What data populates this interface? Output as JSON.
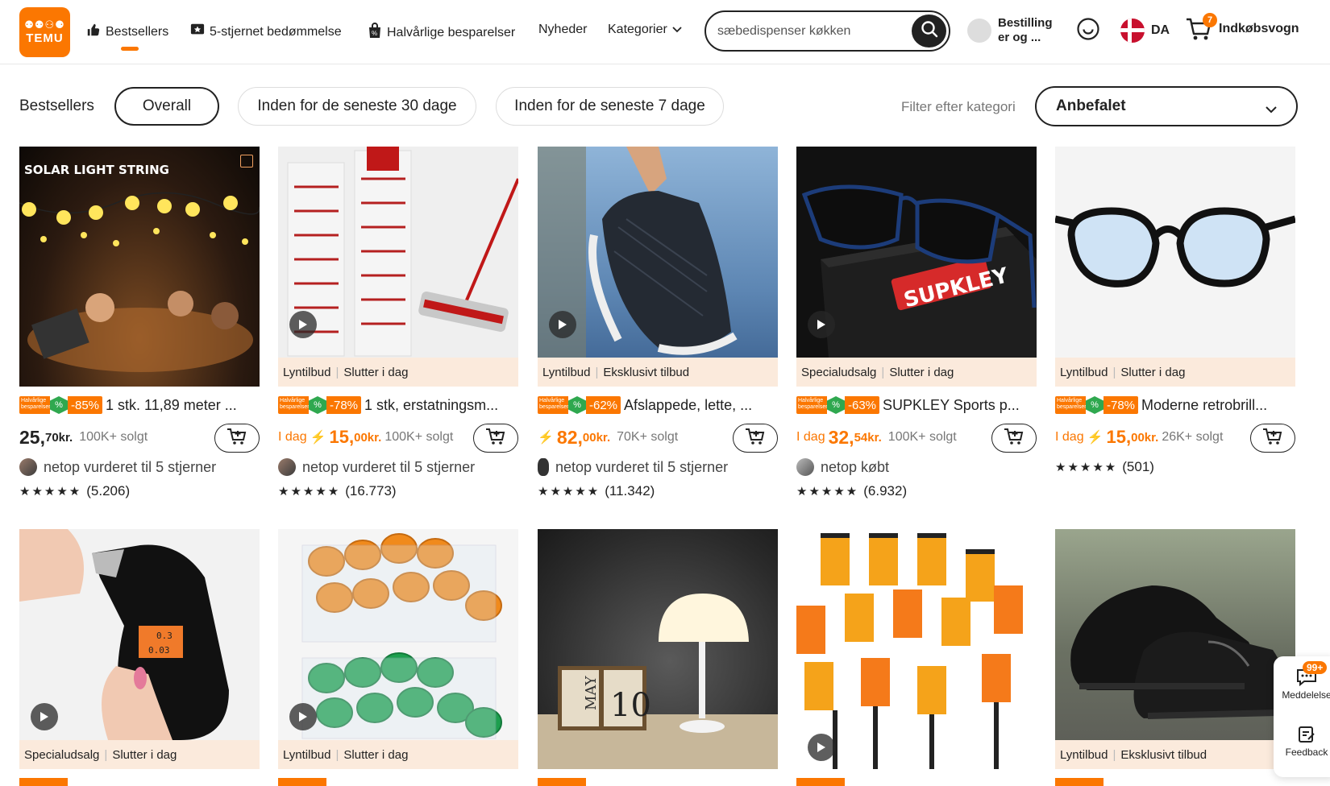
{
  "header": {
    "logo_line1": "⚉⚉⚇⚈",
    "logo_line2": "TEMU",
    "nav": [
      {
        "label": "Bestsellers",
        "icon": "thumbs-up-icon"
      },
      {
        "label": "5-stjernet bedømmelse",
        "icon": "star-badge-icon"
      },
      {
        "label": "Halvårlige besparelser",
        "icon": "shopping-bag-icon"
      },
      {
        "label": "Nyheder"
      },
      {
        "label": "Kategorier",
        "icon": "chevron-down-icon"
      }
    ],
    "search_value": "sæbedispenser køkken",
    "account_label": "Bestilling er og ...",
    "language": "DA",
    "cart_label": "Indkøbsvogn",
    "cart_count": "7"
  },
  "filters": {
    "label": "Bestsellers",
    "pills": [
      "Overall",
      "Inden for de seneste 30 dage",
      "Inden for de seneste 7 dage"
    ],
    "category_label": "Filter efter kategori",
    "sort_value": "Anbefalet"
  },
  "badge_text": "Halvårlige besparelser",
  "products": [
    {
      "tag1": "",
      "tag2": "",
      "discount": "-85%",
      "title": "1 stk. 11,89 meter ...",
      "today": "",
      "price_main": "25,",
      "price_dec": "70kr.",
      "sold": "100K+ solgt",
      "buyer": "netop vurderet til 5 stjerner",
      "rating": "(5.206)",
      "stars": "★★★★★",
      "image_text": "SOLAR LIGHT STRING"
    },
    {
      "tag1": "Lyntilbud",
      "tag2": "Slutter i dag",
      "discount": "-78%",
      "title": "1 stk, erstatningsm...",
      "today": "I dag",
      "price_main": "15,",
      "price_dec": "00kr.",
      "sold": "100K+ solgt",
      "buyer": "netop vurderet til 5 stjerner",
      "rating": "(16.773)",
      "stars": "★★★★★"
    },
    {
      "tag1": "Lyntilbud",
      "tag2": "Eksklusivt tilbud",
      "discount": "-62%",
      "title": "Afslappede, lette, ...",
      "today": "",
      "price_main": "82,",
      "price_dec": "00kr.",
      "sold": "70K+ solgt",
      "buyer": "netop vurderet til 5 stjerner",
      "rating": "(11.342)",
      "stars": "★★★★★"
    },
    {
      "tag1": "Specialudsalg",
      "tag2": "Slutter i dag",
      "discount": "-63%",
      "title": "SUPKLEY Sports p...",
      "today": "I dag",
      "price_main": "32,",
      "price_dec": "54kr.",
      "sold": "100K+ solgt",
      "buyer": "netop købt",
      "rating": "(6.932)",
      "stars": "★★★★★",
      "image_text": "SUPKLEY"
    },
    {
      "tag1": "Lyntilbud",
      "tag2": "Slutter i dag",
      "discount": "-78%",
      "title": "Moderne retrobrill...",
      "today": "I dag",
      "price_main": "15,",
      "price_dec": "00kr.",
      "sold": "26K+ solgt",
      "buyer": "",
      "rating": "(501)",
      "stars": "★★★★★"
    },
    {
      "tag1": "Specialudsalg",
      "tag2": "Slutter i dag",
      "image_text_1": "0.3",
      "image_text_2": "0.03"
    },
    {
      "tag1": "Lyntilbud",
      "tag2": "Slutter i dag"
    },
    {
      "tag1": "",
      "tag2": "",
      "image_text_1": "MAY",
      "image_text_2": "10"
    },
    {
      "tag1": "",
      "tag2": ""
    },
    {
      "tag1": "Lyntilbud",
      "tag2": "Eksklusivt tilbud"
    }
  ],
  "side": {
    "messages_label": "Meddelelse",
    "messages_badge": "99+",
    "feedback_label": "Feedback"
  },
  "colors": {
    "accent": "#fb7701",
    "green": "#2fa84f"
  }
}
